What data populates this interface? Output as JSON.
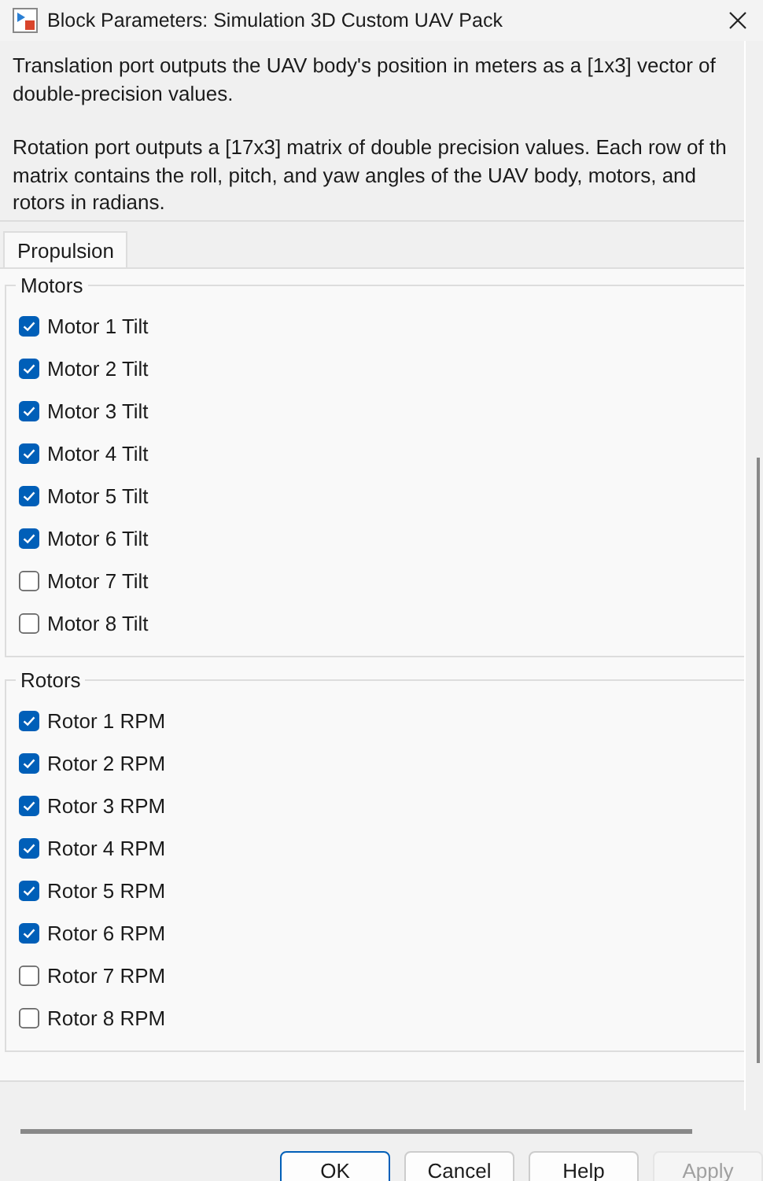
{
  "window": {
    "title": "Block Parameters: Simulation 3D Custom UAV Pack"
  },
  "description": [
    [
      "Translation port outputs the UAV body's position in meters as a [1x3] vector of",
      "double-precision values."
    ],
    [
      "Rotation port outputs a [17x3] matrix of double precision values. Each row of th",
      "matrix contains the roll, pitch, and yaw angles of the UAV body, motors, and",
      "rotors in radians."
    ]
  ],
  "tabs": [
    {
      "label": "Propulsion",
      "selected": true
    }
  ],
  "groups": [
    {
      "title": "Motors",
      "items": [
        {
          "label": "Motor 1 Tilt",
          "checked": true
        },
        {
          "label": "Motor 2 Tilt",
          "checked": true
        },
        {
          "label": "Motor 3 Tilt",
          "checked": true
        },
        {
          "label": "Motor 4 Tilt",
          "checked": true
        },
        {
          "label": "Motor 5 Tilt",
          "checked": true
        },
        {
          "label": "Motor 6 Tilt",
          "checked": true
        },
        {
          "label": "Motor 7 Tilt",
          "checked": false
        },
        {
          "label": "Motor 8 Tilt",
          "checked": false
        }
      ]
    },
    {
      "title": "Rotors",
      "items": [
        {
          "label": "Rotor 1 RPM",
          "checked": true
        },
        {
          "label": "Rotor 2 RPM",
          "checked": true
        },
        {
          "label": "Rotor 3 RPM",
          "checked": true
        },
        {
          "label": "Rotor 4 RPM",
          "checked": true
        },
        {
          "label": "Rotor 5 RPM",
          "checked": true
        },
        {
          "label": "Rotor 6 RPM",
          "checked": true
        },
        {
          "label": "Rotor 7 RPM",
          "checked": false
        },
        {
          "label": "Rotor 8 RPM",
          "checked": false
        }
      ]
    }
  ],
  "buttons": [
    {
      "label": "OK",
      "kind": "default",
      "disabled": false
    },
    {
      "label": "Cancel",
      "kind": "normal",
      "disabled": false
    },
    {
      "label": "Help",
      "kind": "normal",
      "disabled": false
    },
    {
      "label": "Apply",
      "kind": "normal",
      "disabled": true
    }
  ]
}
